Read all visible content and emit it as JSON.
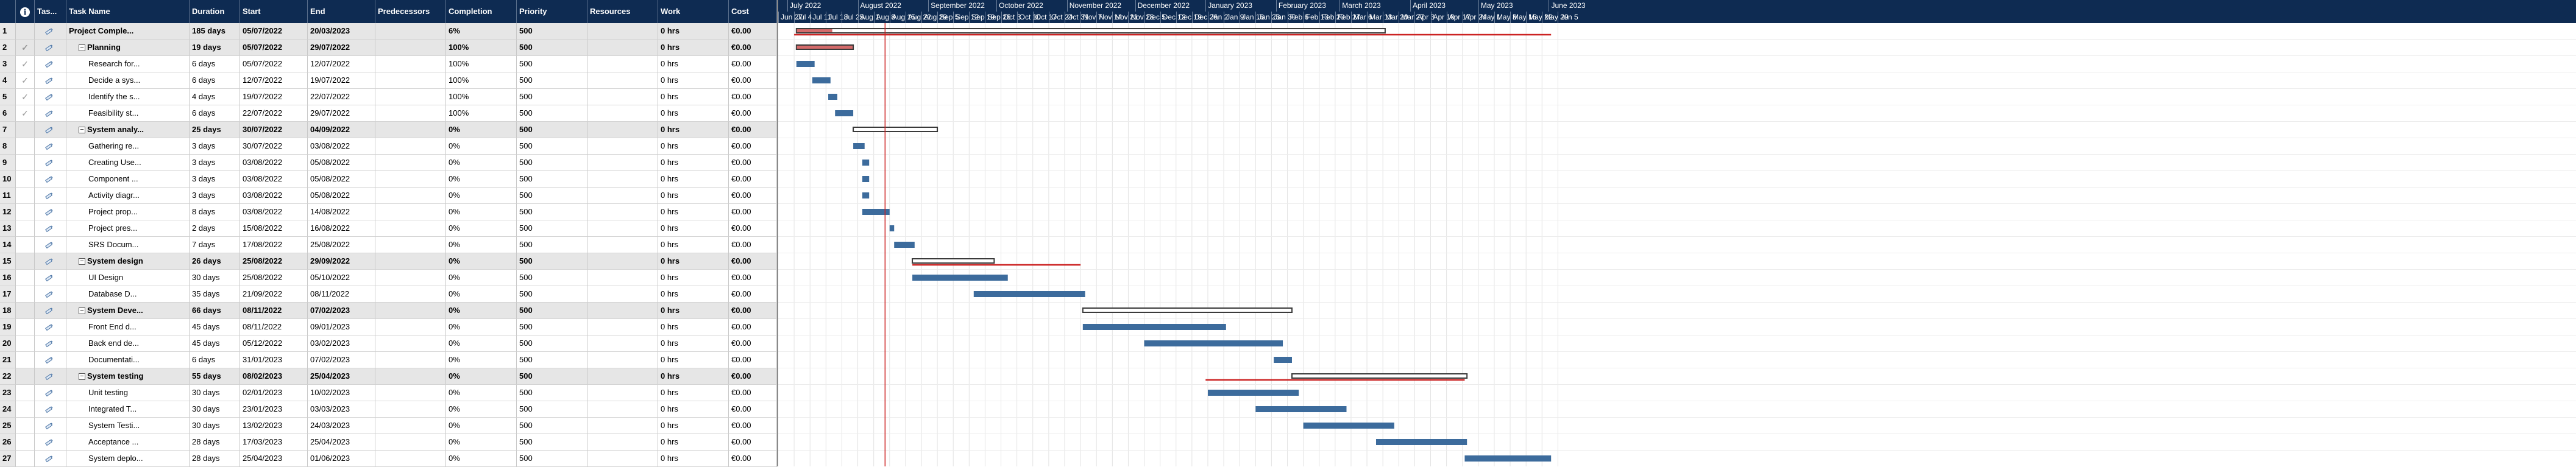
{
  "columns": {
    "info": "i",
    "mode": "Tas...",
    "name": "Task Name",
    "duration": "Duration",
    "start": "Start",
    "end": "End",
    "predecessors": "Predecessors",
    "completion": "Completion",
    "priority": "Priority",
    "resources": "Resources",
    "work": "Work",
    "cost": "Cost"
  },
  "icons": {
    "check": "check-icon",
    "mode": "auto-schedule-icon",
    "collapse": "collapse-minus-icon",
    "info": "info-icon"
  },
  "colors": {
    "header_bg": "#0e2b52",
    "summary_row_bg": "#e6e6e6",
    "task_bar": "#3c6b9c",
    "summary_bar": "#3a3a3a",
    "progress_bar": "#d46a6a",
    "baseline_line": "#cc2222",
    "today_line": "#cc2222"
  },
  "timeline": {
    "months": [
      {
        "label": "July 2022",
        "date": "2022-07-01"
      },
      {
        "label": "August 2022",
        "date": "2022-08-01"
      },
      {
        "label": "September 2022",
        "date": "2022-09-01"
      },
      {
        "label": "October 2022",
        "date": "2022-10-01"
      },
      {
        "label": "November 2022",
        "date": "2022-11-01"
      },
      {
        "label": "December 2022",
        "date": "2022-12-01"
      },
      {
        "label": "January 2023",
        "date": "2023-01-01"
      },
      {
        "label": "February 2023",
        "date": "2023-02-01"
      },
      {
        "label": "March 2023",
        "date": "2023-03-01"
      },
      {
        "label": "April 2023",
        "date": "2023-04-01"
      },
      {
        "label": "May 2023",
        "date": "2023-05-01"
      },
      {
        "label": "June 2023",
        "date": "2023-06-01"
      }
    ],
    "weeks": [
      {
        "label": "Jun 27",
        "date": "2022-06-27"
      },
      {
        "label": "Jul 4",
        "date": "2022-07-04"
      },
      {
        "label": "Jul 11",
        "date": "2022-07-11"
      },
      {
        "label": "Jul 18",
        "date": "2022-07-18"
      },
      {
        "label": "Jul 25",
        "date": "2022-07-25"
      },
      {
        "label": "Aug 1",
        "date": "2022-08-01"
      },
      {
        "label": "Aug 8",
        "date": "2022-08-08"
      },
      {
        "label": "Aug 15",
        "date": "2022-08-15"
      },
      {
        "label": "Aug 22",
        "date": "2022-08-22"
      },
      {
        "label": "Aug 29",
        "date": "2022-08-29"
      },
      {
        "label": "Sep 5",
        "date": "2022-09-05"
      },
      {
        "label": "Sep 12",
        "date": "2022-09-12"
      },
      {
        "label": "Sep 19",
        "date": "2022-09-19"
      },
      {
        "label": "Sep 26",
        "date": "2022-09-26"
      },
      {
        "label": "Oct 3",
        "date": "2022-10-03"
      },
      {
        "label": "Oct 10",
        "date": "2022-10-10"
      },
      {
        "label": "Oct 17",
        "date": "2022-10-17"
      },
      {
        "label": "Oct 24",
        "date": "2022-10-24"
      },
      {
        "label": "Oct 31",
        "date": "2022-10-31"
      },
      {
        "label": "Nov 7",
        "date": "2022-11-07"
      },
      {
        "label": "Nov 14",
        "date": "2022-11-14"
      },
      {
        "label": "Nov 21",
        "date": "2022-11-21"
      },
      {
        "label": "Nov 28",
        "date": "2022-11-28"
      },
      {
        "label": "Dec 5",
        "date": "2022-12-05"
      },
      {
        "label": "Dec 12",
        "date": "2022-12-12"
      },
      {
        "label": "Dec 19",
        "date": "2022-12-19"
      },
      {
        "label": "Dec 26",
        "date": "2022-12-26"
      },
      {
        "label": "Jan 2",
        "date": "2023-01-02"
      },
      {
        "label": "Jan 9",
        "date": "2023-01-09"
      },
      {
        "label": "Jan 16",
        "date": "2023-01-16"
      },
      {
        "label": "Jan 23",
        "date": "2023-01-23"
      },
      {
        "label": "Jan 30",
        "date": "2023-01-30"
      },
      {
        "label": "Feb 6",
        "date": "2023-02-06"
      },
      {
        "label": "Feb 13",
        "date": "2023-02-13"
      },
      {
        "label": "Feb 20",
        "date": "2023-02-20"
      },
      {
        "label": "Feb 27",
        "date": "2023-02-27"
      },
      {
        "label": "Mar 6",
        "date": "2023-03-06"
      },
      {
        "label": "Mar 13",
        "date": "2023-03-13"
      },
      {
        "label": "Mar 20",
        "date": "2023-03-20"
      },
      {
        "label": "Mar 27",
        "date": "2023-03-27"
      },
      {
        "label": "Apr 3",
        "date": "2023-04-03"
      },
      {
        "label": "Apr 10",
        "date": "2023-04-10"
      },
      {
        "label": "Apr 17",
        "date": "2023-04-17"
      },
      {
        "label": "Apr 24",
        "date": "2023-04-24"
      },
      {
        "label": "May 1",
        "date": "2023-05-01"
      },
      {
        "label": "May 8",
        "date": "2023-05-08"
      },
      {
        "label": "May 15",
        "date": "2023-05-15"
      },
      {
        "label": "May 22",
        "date": "2023-05-22"
      },
      {
        "label": "May 29",
        "date": "2023-05-29"
      },
      {
        "label": "Jun 5",
        "date": "2023-06-05"
      }
    ],
    "today": "2022-08-13",
    "project_deadline": "2023-06-02"
  },
  "tasks": [
    {
      "id": "1",
      "name": "Project Comple...",
      "duration": "185 days",
      "start": "05/07/2022",
      "end": "20/03/2023",
      "predecessors": "",
      "completion": "6%",
      "priority": "500",
      "resources": "",
      "work": "0 hrs",
      "cost": "€0.00",
      "level": 0,
      "summary": true,
      "collapsible": false,
      "done": false,
      "progress": 0.06
    },
    {
      "id": "2",
      "name": "Planning",
      "duration": "19 days",
      "start": "05/07/2022",
      "end": "29/07/2022",
      "predecessors": "",
      "completion": "100%",
      "priority": "500",
      "resources": "",
      "work": "0 hrs",
      "cost": "€0.00",
      "level": 1,
      "summary": true,
      "collapsible": true,
      "done": true,
      "progress": 1.0
    },
    {
      "id": "3",
      "name": "Research for...",
      "duration": "6 days",
      "start": "05/07/2022",
      "end": "12/07/2022",
      "predecessors": "",
      "completion": "100%",
      "priority": "500",
      "resources": "",
      "work": "0 hrs",
      "cost": "€0.00",
      "level": 2,
      "summary": false,
      "collapsible": false,
      "done": true,
      "progress": 1.0
    },
    {
      "id": "4",
      "name": "Decide a sys...",
      "duration": "6 days",
      "start": "12/07/2022",
      "end": "19/07/2022",
      "predecessors": "",
      "completion": "100%",
      "priority": "500",
      "resources": "",
      "work": "0 hrs",
      "cost": "€0.00",
      "level": 2,
      "summary": false,
      "collapsible": false,
      "done": true,
      "progress": 1.0
    },
    {
      "id": "5",
      "name": "Identify the s...",
      "duration": "4 days",
      "start": "19/07/2022",
      "end": "22/07/2022",
      "predecessors": "",
      "completion": "100%",
      "priority": "500",
      "resources": "",
      "work": "0 hrs",
      "cost": "€0.00",
      "level": 2,
      "summary": false,
      "collapsible": false,
      "done": true,
      "progress": 1.0
    },
    {
      "id": "6",
      "name": "Feasibility st...",
      "duration": "6 days",
      "start": "22/07/2022",
      "end": "29/07/2022",
      "predecessors": "",
      "completion": "100%",
      "priority": "500",
      "resources": "",
      "work": "0 hrs",
      "cost": "€0.00",
      "level": 2,
      "summary": false,
      "collapsible": false,
      "done": true,
      "progress": 1.0
    },
    {
      "id": "7",
      "name": "System analy...",
      "duration": "25 days",
      "start": "30/07/2022",
      "end": "04/09/2022",
      "predecessors": "",
      "completion": "0%",
      "priority": "500",
      "resources": "",
      "work": "0 hrs",
      "cost": "€0.00",
      "level": 1,
      "summary": true,
      "collapsible": true,
      "done": false,
      "progress": 0
    },
    {
      "id": "8",
      "name": "Gathering re...",
      "duration": "3 days",
      "start": "30/07/2022",
      "end": "03/08/2022",
      "predecessors": "",
      "completion": "0%",
      "priority": "500",
      "resources": "",
      "work": "0 hrs",
      "cost": "€0.00",
      "level": 2,
      "summary": false,
      "collapsible": false,
      "done": false,
      "progress": 0
    },
    {
      "id": "9",
      "name": "Creating Use...",
      "duration": "3 days",
      "start": "03/08/2022",
      "end": "05/08/2022",
      "predecessors": "",
      "completion": "0%",
      "priority": "500",
      "resources": "",
      "work": "0 hrs",
      "cost": "€0.00",
      "level": 2,
      "summary": false,
      "collapsible": false,
      "done": false,
      "progress": 0
    },
    {
      "id": "10",
      "name": "Component ...",
      "duration": "3 days",
      "start": "03/08/2022",
      "end": "05/08/2022",
      "predecessors": "",
      "completion": "0%",
      "priority": "500",
      "resources": "",
      "work": "0 hrs",
      "cost": "€0.00",
      "level": 2,
      "summary": false,
      "collapsible": false,
      "done": false,
      "progress": 0
    },
    {
      "id": "11",
      "name": "Activity diagr...",
      "duration": "3 days",
      "start": "03/08/2022",
      "end": "05/08/2022",
      "predecessors": "",
      "completion": "0%",
      "priority": "500",
      "resources": "",
      "work": "0 hrs",
      "cost": "€0.00",
      "level": 2,
      "summary": false,
      "collapsible": false,
      "done": false,
      "progress": 0
    },
    {
      "id": "12",
      "name": "Project prop...",
      "duration": "8 days",
      "start": "03/08/2022",
      "end": "14/08/2022",
      "predecessors": "",
      "completion": "0%",
      "priority": "500",
      "resources": "",
      "work": "0 hrs",
      "cost": "€0.00",
      "level": 2,
      "summary": false,
      "collapsible": false,
      "done": false,
      "progress": 0
    },
    {
      "id": "13",
      "name": "Project pres...",
      "duration": "2 days",
      "start": "15/08/2022",
      "end": "16/08/2022",
      "predecessors": "",
      "completion": "0%",
      "priority": "500",
      "resources": "",
      "work": "0 hrs",
      "cost": "€0.00",
      "level": 2,
      "summary": false,
      "collapsible": false,
      "done": false,
      "progress": 0
    },
    {
      "id": "14",
      "name": "SRS Docum...",
      "duration": "7 days",
      "start": "17/08/2022",
      "end": "25/08/2022",
      "predecessors": "",
      "completion": "0%",
      "priority": "500",
      "resources": "",
      "work": "0 hrs",
      "cost": "€0.00",
      "level": 2,
      "summary": false,
      "collapsible": false,
      "done": false,
      "progress": 0
    },
    {
      "id": "15",
      "name": "System design",
      "duration": "26 days",
      "start": "25/08/2022",
      "end": "29/09/2022",
      "predecessors": "",
      "completion": "0%",
      "priority": "500",
      "resources": "",
      "work": "0 hrs",
      "cost": "€0.00",
      "level": 1,
      "summary": true,
      "collapsible": true,
      "done": false,
      "progress": 0
    },
    {
      "id": "16",
      "name": "UI Design",
      "duration": "30 days",
      "start": "25/08/2022",
      "end": "05/10/2022",
      "predecessors": "",
      "completion": "0%",
      "priority": "500",
      "resources": "",
      "work": "0 hrs",
      "cost": "€0.00",
      "level": 2,
      "summary": false,
      "collapsible": false,
      "done": false,
      "progress": 0
    },
    {
      "id": "17",
      "name": "Database D...",
      "duration": "35 days",
      "start": "21/09/2022",
      "end": "08/11/2022",
      "predecessors": "",
      "completion": "0%",
      "priority": "500",
      "resources": "",
      "work": "0 hrs",
      "cost": "€0.00",
      "level": 2,
      "summary": false,
      "collapsible": false,
      "done": false,
      "progress": 0
    },
    {
      "id": "18",
      "name": "System Deve...",
      "duration": "66 days",
      "start": "08/11/2022",
      "end": "07/02/2023",
      "predecessors": "",
      "completion": "0%",
      "priority": "500",
      "resources": "",
      "work": "0 hrs",
      "cost": "€0.00",
      "level": 1,
      "summary": true,
      "collapsible": true,
      "done": false,
      "progress": 0
    },
    {
      "id": "19",
      "name": "Front End d...",
      "duration": "45 days",
      "start": "08/11/2022",
      "end": "09/01/2023",
      "predecessors": "",
      "completion": "0%",
      "priority": "500",
      "resources": "",
      "work": "0 hrs",
      "cost": "€0.00",
      "level": 2,
      "summary": false,
      "collapsible": false,
      "done": false,
      "progress": 0
    },
    {
      "id": "20",
      "name": "Back end de...",
      "duration": "45 days",
      "start": "05/12/2022",
      "end": "03/02/2023",
      "predecessors": "",
      "completion": "0%",
      "priority": "500",
      "resources": "",
      "work": "0 hrs",
      "cost": "€0.00",
      "level": 2,
      "summary": false,
      "collapsible": false,
      "done": false,
      "progress": 0
    },
    {
      "id": "21",
      "name": "Documentati...",
      "duration": "6 days",
      "start": "31/01/2023",
      "end": "07/02/2023",
      "predecessors": "",
      "completion": "0%",
      "priority": "500",
      "resources": "",
      "work": "0 hrs",
      "cost": "€0.00",
      "level": 2,
      "summary": false,
      "collapsible": false,
      "done": false,
      "progress": 0
    },
    {
      "id": "22",
      "name": "System testing",
      "duration": "55 days",
      "start": "08/02/2023",
      "end": "25/04/2023",
      "predecessors": "",
      "completion": "0%",
      "priority": "500",
      "resources": "",
      "work": "0 hrs",
      "cost": "€0.00",
      "level": 1,
      "summary": true,
      "collapsible": true,
      "done": false,
      "progress": 0
    },
    {
      "id": "23",
      "name": "Unit testing",
      "duration": "30 days",
      "start": "02/01/2023",
      "end": "10/02/2023",
      "predecessors": "",
      "completion": "0%",
      "priority": "500",
      "resources": "",
      "work": "0 hrs",
      "cost": "€0.00",
      "level": 2,
      "summary": false,
      "collapsible": false,
      "done": false,
      "progress": 0
    },
    {
      "id": "24",
      "name": "Integrated T...",
      "duration": "30 days",
      "start": "23/01/2023",
      "end": "03/03/2023",
      "predecessors": "",
      "completion": "0%",
      "priority": "500",
      "resources": "",
      "work": "0 hrs",
      "cost": "€0.00",
      "level": 2,
      "summary": false,
      "collapsible": false,
      "done": false,
      "progress": 0
    },
    {
      "id": "25",
      "name": "System Testi...",
      "duration": "30 days",
      "start": "13/02/2023",
      "end": "24/03/2023",
      "predecessors": "",
      "completion": "0%",
      "priority": "500",
      "resources": "",
      "work": "0 hrs",
      "cost": "€0.00",
      "level": 2,
      "summary": false,
      "collapsible": false,
      "done": false,
      "progress": 0
    },
    {
      "id": "26",
      "name": "Acceptance ...",
      "duration": "28 days",
      "start": "17/03/2023",
      "end": "25/04/2023",
      "predecessors": "",
      "completion": "0%",
      "priority": "500",
      "resources": "",
      "work": "0 hrs",
      "cost": "€0.00",
      "level": 2,
      "summary": false,
      "collapsible": false,
      "done": false,
      "progress": 0
    },
    {
      "id": "27",
      "name": "System deplo...",
      "duration": "28 days",
      "start": "25/04/2023",
      "end": "01/06/2023",
      "predecessors": "",
      "completion": "0%",
      "priority": "500",
      "resources": "",
      "work": "0 hrs",
      "cost": "€0.00",
      "level": 2,
      "summary": false,
      "collapsible": false,
      "done": false,
      "progress": 0
    }
  ],
  "overlay_lines": [
    {
      "row": "1",
      "start": "2022-07-04",
      "end": "2023-06-02"
    },
    {
      "row": "15",
      "start": "2022-08-25",
      "end": "2022-11-07"
    },
    {
      "row": "22",
      "start": "2023-01-01",
      "end": "2023-04-25"
    }
  ]
}
